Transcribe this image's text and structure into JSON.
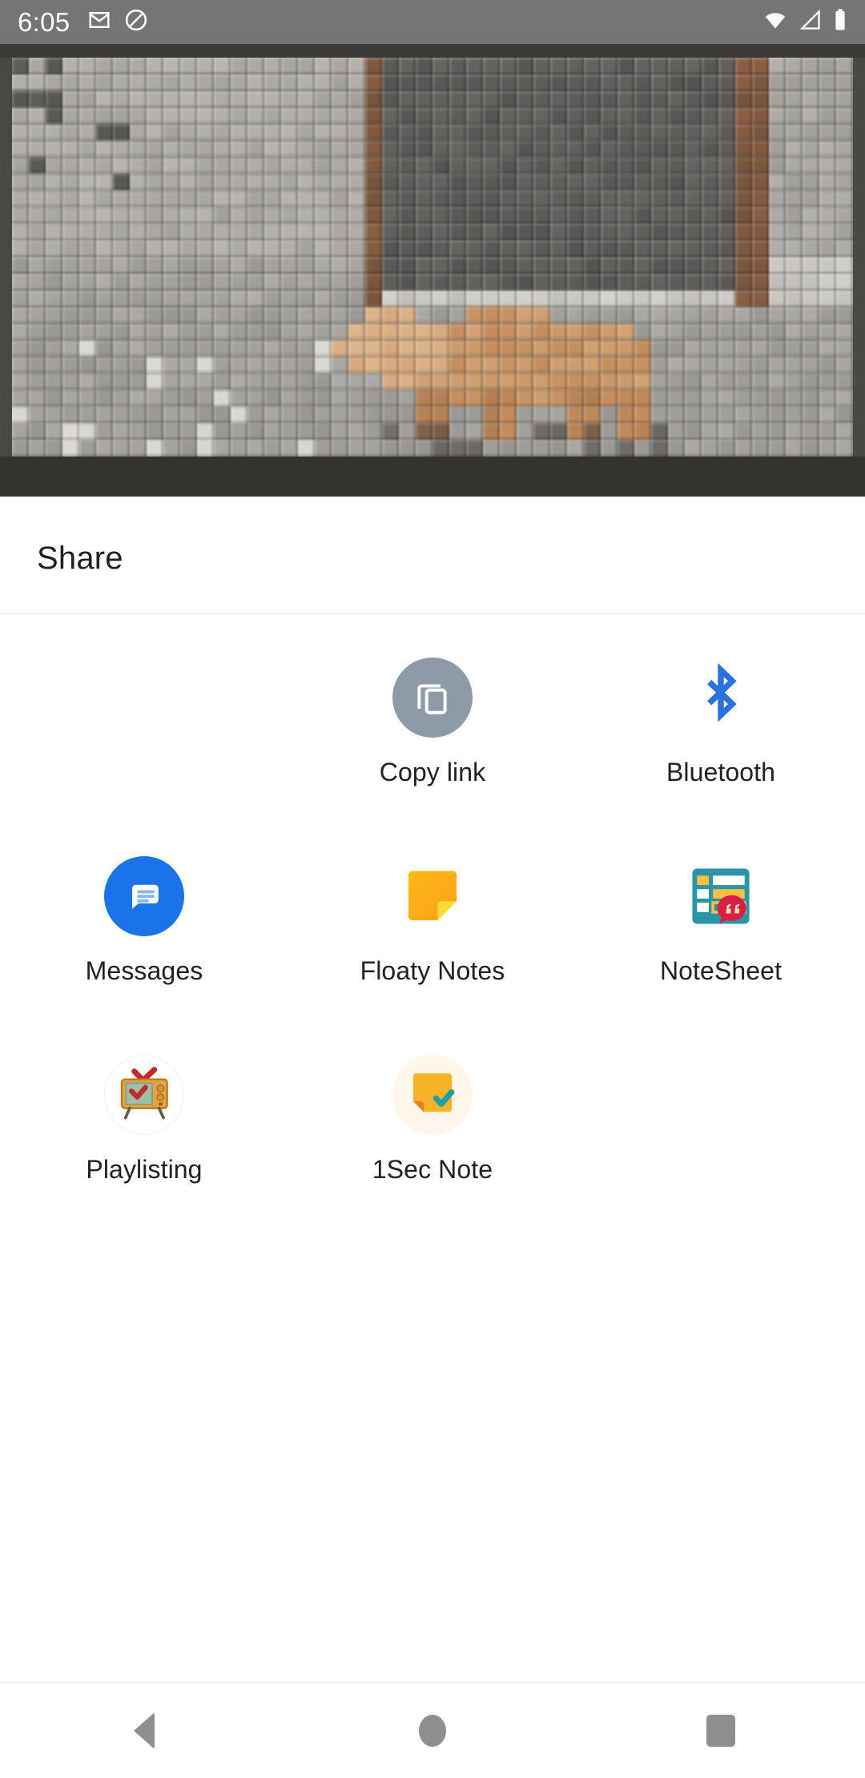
{
  "status_bar": {
    "clock": "6:05",
    "left_icons": [
      "gmail-icon",
      "do-not-disturb-icon"
    ],
    "right_icons": [
      "wifi-icon",
      "cell-signal-icon",
      "battery-icon"
    ],
    "background_color": "#757575",
    "foreground_color": "#ffffff"
  },
  "preview": {
    "name": "shared-image-preview",
    "description": "pixelated mosaic photo of a tan dog beside a grey brick wall",
    "background_color": "#4a4845"
  },
  "sheet": {
    "title": "Share",
    "background_color": "#ffffff",
    "rows": [
      [
        {
          "label": "",
          "icon": "empty-slot",
          "empty": true
        },
        {
          "label": "Copy link",
          "icon": "copy-link-icon",
          "accent": "#8e9aa8"
        },
        {
          "label": "Bluetooth",
          "icon": "bluetooth-icon",
          "accent": "#2a72e0"
        }
      ],
      [
        {
          "label": "Messages",
          "icon": "google-messages-icon",
          "accent": "#1a73e8"
        },
        {
          "label": "Floaty Notes",
          "icon": "sticky-note-icon",
          "accent": "#f9a825"
        },
        {
          "label": "NoteSheet",
          "icon": "notesheet-icon",
          "accent": "#2a94a9"
        }
      ],
      [
        {
          "label": "Playlisting",
          "icon": "retro-tv-icon",
          "accent": "#e8a33d"
        },
        {
          "label": "1Sec Note",
          "icon": "note-check-icon",
          "accent": "#f8b227"
        },
        {
          "label": "",
          "icon": "empty-slot",
          "empty": true
        }
      ]
    ]
  },
  "navigation_bar": {
    "back_label": "Back",
    "home_label": "Home",
    "recents_label": "Recents",
    "icon_color": "#8f8f8f"
  }
}
